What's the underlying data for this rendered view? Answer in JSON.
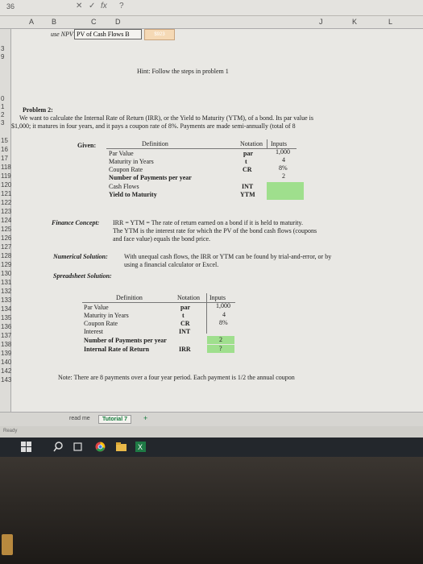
{
  "toolbar": {
    "cell_ref": "36",
    "icons": [
      "close-icon",
      "check-icon",
      "function-icon",
      "help-icon"
    ],
    "fx": "fx",
    "help": "?"
  },
  "columns": [
    "A",
    "B",
    "C",
    "D",
    "J",
    "K",
    "L"
  ],
  "rows": [
    "3",
    "9",
    "0",
    "1",
    "2",
    "3",
    "15",
    "16",
    "17",
    "118",
    "119",
    "120",
    "121",
    "122",
    "123",
    "124",
    "125",
    "126",
    "127",
    "128",
    "129",
    "130",
    "131",
    "132",
    "133",
    "134",
    "135",
    "136",
    "137",
    "138",
    "139",
    "140",
    "142",
    "143"
  ],
  "header_row": {
    "b": "use NPV>",
    "c": "PV of Cash Flows B",
    "d": "$923"
  },
  "hint": "Hint: Follow the steps in problem 1",
  "problem": {
    "title": "Problem 2:",
    "line1": "We want to calculate the Internal Rate of Return (IRR), or the Yield to Maturity (YTM), of a bond. Its par value is",
    "line2": "$1,000; it matures in four years, and it pays a coupon rate of 8%. Payments are made semi-annually (total of 8"
  },
  "given": {
    "label": "Given:",
    "hdr_def": "Definition",
    "hdr_notation": "Notation",
    "hdr_inputs": "Inputs",
    "rows": [
      {
        "def": "Par Value",
        "notation": "par",
        "input": "1,000"
      },
      {
        "def": "Maturity in Years",
        "notation": "t",
        "input": "4"
      },
      {
        "def": "Coupon Rate",
        "notation": "CR",
        "input": "8%"
      },
      {
        "def": "Number of Payments per year",
        "notation": "",
        "input": "2"
      },
      {
        "def": "Cash Flows",
        "notation": "INT",
        "input": ""
      },
      {
        "def": "Yield to Maturity",
        "notation": "YTM",
        "input": ""
      }
    ]
  },
  "concept": {
    "label": "Finance Concept:",
    "line1": "IRR = YTM = The rate of return earned on a bond if it is held to maturity.",
    "line2": "The YTM is the interest rate for which the PV of the bond cash flows (coupons",
    "line3": "and face value) equals the bond price."
  },
  "numerical": {
    "label": "Numerical Solution:",
    "line1": "With unequal cash flows, the IRR or YTM can be found by trial-and-error, or by",
    "line2": "using a financial calculator or Excel."
  },
  "spreadsheet": {
    "label": "Spreadsheet Solution:",
    "hdr_def": "Definition",
    "hdr_notation": "Notation",
    "hdr_inputs": "Inputs",
    "rows": [
      {
        "def": "Par Value",
        "notation": "par",
        "input": "1,000"
      },
      {
        "def": "Maturity in Years",
        "notation": "t",
        "input": "4"
      },
      {
        "def": "Coupon Rate",
        "notation": "CR",
        "input": "8%"
      },
      {
        "def": "Interest",
        "notation": "INT",
        "input": ""
      },
      {
        "def": "Number of Payments per year",
        "notation": "",
        "input": "2"
      },
      {
        "def": "Internal Rate of Return",
        "notation": "IRR",
        "input": "?"
      }
    ]
  },
  "note": "Note: There are 8 payments over a four year period. Each payment is 1/2 the annual coupon",
  "tabs": {
    "t1": "read me",
    "t2": "Tutorial 7",
    "add": "+"
  },
  "status": "Ready",
  "colors": {
    "accent_green": "#9fdf8d",
    "excel_green": "#117a3a",
    "taskbar": "#23272c"
  }
}
